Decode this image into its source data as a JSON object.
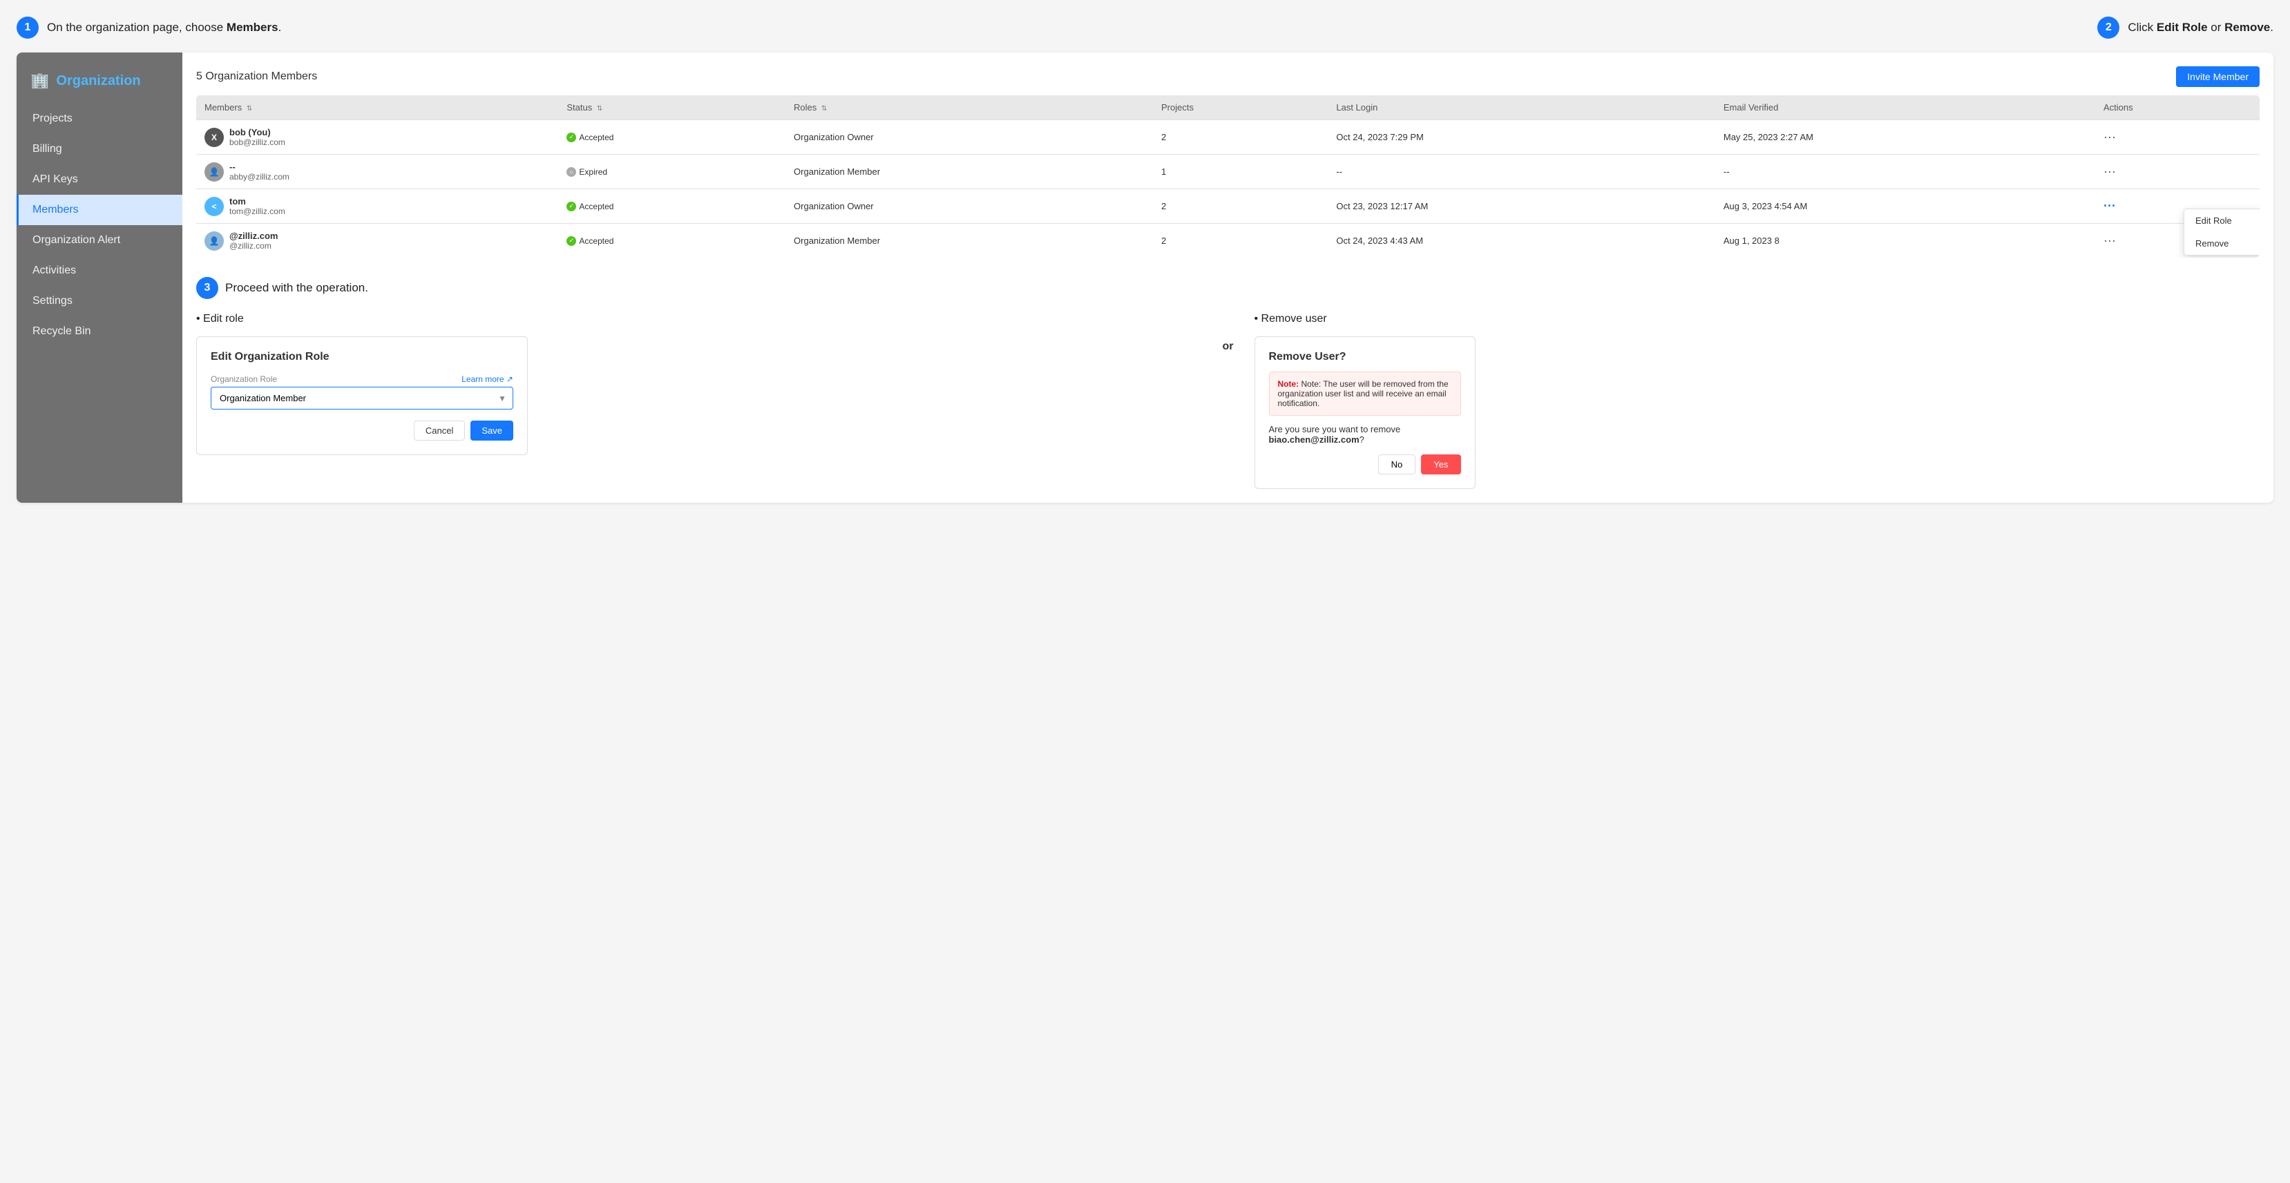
{
  "step1": {
    "circle": "1",
    "text_prefix": "On the organization page, choose ",
    "text_bold": "Members",
    "text_suffix": "."
  },
  "step2_header": {
    "circle": "2",
    "text_prefix": "Click ",
    "text_bold1": "Edit Role",
    "text_middle": " or ",
    "text_bold2": "Remove",
    "text_suffix": "."
  },
  "step3": {
    "circle": "3",
    "text": "Proceed with the operation."
  },
  "sidebar": {
    "brand": "Organization",
    "brand_icon": "🏢",
    "items": [
      {
        "label": "Projects",
        "active": false
      },
      {
        "label": "Billing",
        "active": false
      },
      {
        "label": "API Keys",
        "active": false
      },
      {
        "label": "Members",
        "active": true
      },
      {
        "label": "Organization Alert",
        "active": false
      },
      {
        "label": "Activities",
        "active": false
      },
      {
        "label": "Settings",
        "active": false
      },
      {
        "label": "Recycle Bin",
        "active": false
      }
    ]
  },
  "table": {
    "title": "5 Organization Members",
    "invite_button": "Invite Member",
    "columns": [
      "Members",
      "Status",
      "Roles",
      "Projects",
      "Last Login",
      "Email Verified",
      "Actions"
    ],
    "rows": [
      {
        "name": "bob (You)",
        "email": "bob@zilliz.com",
        "avatar_text": "X",
        "avatar_color": "dark",
        "status": "Accepted",
        "status_type": "green",
        "role": "Organization Owner",
        "projects": "2",
        "last_login": "Oct 24, 2023 7:29 PM",
        "email_verified": "May 25, 2023 2:27 AM",
        "highlighted": false
      },
      {
        "name": "--",
        "email": "abby@zilliz.com",
        "avatar_text": "👤",
        "avatar_color": "gray",
        "status": "Expired",
        "status_type": "gray",
        "role": "Organization Member",
        "projects": "1",
        "last_login": "--",
        "email_verified": "--",
        "highlighted": false
      },
      {
        "name": "tom",
        "email": "tom@zilliz.com",
        "avatar_text": "<",
        "avatar_color": "blue",
        "status": "Accepted",
        "status_type": "green",
        "role": "Organization Owner",
        "projects": "2",
        "last_login": "Oct 23, 2023 12:17 AM",
        "email_verified": "Aug 3, 2023 4:54 AM",
        "highlighted": true,
        "show_dropdown": true
      },
      {
        "name": "@zilliz.com",
        "email": "@zilliz.com",
        "avatar_text": "👤",
        "avatar_color": "blue2",
        "status": "Accepted",
        "status_type": "green",
        "role": "Organization Member",
        "projects": "2",
        "last_login": "Oct 24, 2023 4:43 AM",
        "email_verified": "Aug 1, 2023 8",
        "highlighted": false
      }
    ],
    "dropdown": {
      "items": [
        "Edit Role",
        "Remove"
      ]
    }
  },
  "edit_role": {
    "bullet": "Edit role",
    "modal_title": "Edit Organization Role",
    "form_label": "Organization Role",
    "learn_more": "Learn more ↗",
    "select_value": "Organization Member",
    "cancel_label": "Cancel",
    "save_label": "Save"
  },
  "or_divider": "or",
  "remove_user": {
    "bullet": "Remove user",
    "modal_title": "Remove User?",
    "warning_text": "Note: The user will be removed from the organization user list and will receive an email notification.",
    "confirm_prefix": "Are you sure you want to remove ",
    "confirm_email": "biao.chen@zilliz.com",
    "confirm_suffix": "?",
    "no_label": "No",
    "yes_label": "Yes"
  }
}
